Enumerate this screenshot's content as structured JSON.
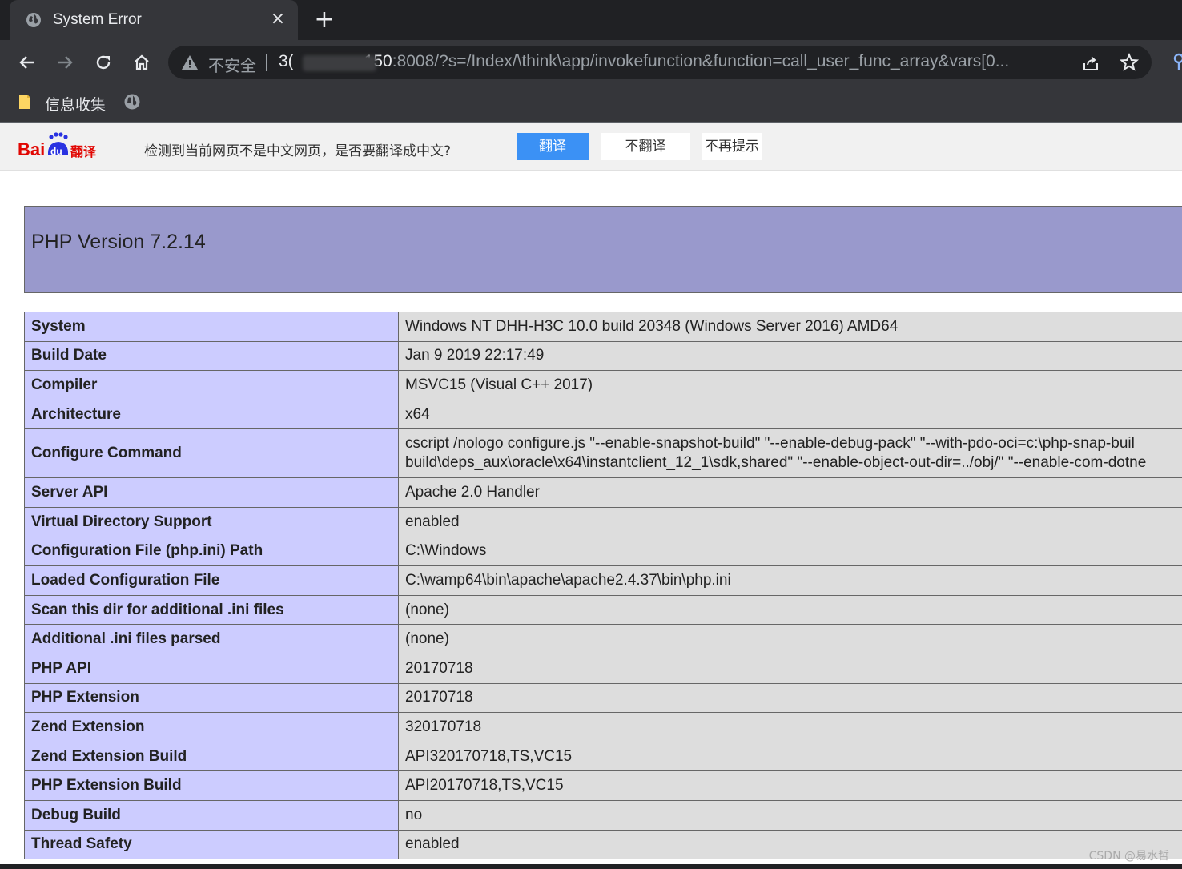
{
  "tab": {
    "title": "System Error",
    "close": "×",
    "new": "+"
  },
  "omnibox": {
    "insecure_label": "不安全",
    "url_host_start": "3(",
    "url_host_end": "150",
    "url_rest": ":8008/?s=/Index/\\think\\app/invokefunction&function=call_user_func_array&vars[0..."
  },
  "bookmarks": {
    "folder_label": "信息收集"
  },
  "translate": {
    "prompt": "检测到当前网页不是中文网页，是否要翻译成中文?",
    "translate_btn": "翻译",
    "no_translate_btn": "不翻译",
    "never_prompt": "不再提示",
    "logo_text_a": "Bai",
    "logo_text_b": "翻译"
  },
  "php": {
    "version_title": "PHP Version 7.2.14",
    "rows": [
      {
        "key": "System",
        "value": "Windows NT DHH-H3C 10.0 build 20348 (Windows Server 2016) AMD64"
      },
      {
        "key": "Build Date",
        "value": "Jan 9 2019 22:17:49"
      },
      {
        "key": "Compiler",
        "value": "MSVC15 (Visual C++ 2017)"
      },
      {
        "key": "Architecture",
        "value": "x64"
      },
      {
        "key": "Configure Command",
        "value_line1": "cscript /nologo configure.js \"--enable-snapshot-build\" \"--enable-debug-pack\" \"--with-pdo-oci=c:\\php-snap-buil",
        "value_line2": "build\\deps_aux\\oracle\\x64\\instantclient_12_1\\sdk,shared\" \"--enable-object-out-dir=../obj/\" \"--enable-com-dotne"
      },
      {
        "key": "Server API",
        "value": "Apache 2.0 Handler"
      },
      {
        "key": "Virtual Directory Support",
        "value": "enabled"
      },
      {
        "key": "Configuration File (php.ini) Path",
        "value": "C:\\Windows"
      },
      {
        "key": "Loaded Configuration File",
        "value": "C:\\wamp64\\bin\\apache\\apache2.4.37\\bin\\php.ini"
      },
      {
        "key": "Scan this dir for additional .ini files",
        "value": "(none)"
      },
      {
        "key": "Additional .ini files parsed",
        "value": "(none)"
      },
      {
        "key": "PHP API",
        "value": "20170718"
      },
      {
        "key": "PHP Extension",
        "value": "20170718"
      },
      {
        "key": "Zend Extension",
        "value": "320170718"
      },
      {
        "key": "Zend Extension Build",
        "value": "API320170718,TS,VC15"
      },
      {
        "key": "PHP Extension Build",
        "value": "API20170718,TS,VC15"
      },
      {
        "key": "Debug Build",
        "value": "no"
      },
      {
        "key": "Thread Safety",
        "value": "enabled"
      }
    ]
  },
  "watermark": "CSDN @易水哲",
  "colors": {
    "header_bg": "#9999cc",
    "key_bg": "#ccccff",
    "value_bg": "#dddddd",
    "translate_btn": "#3b91f5"
  }
}
